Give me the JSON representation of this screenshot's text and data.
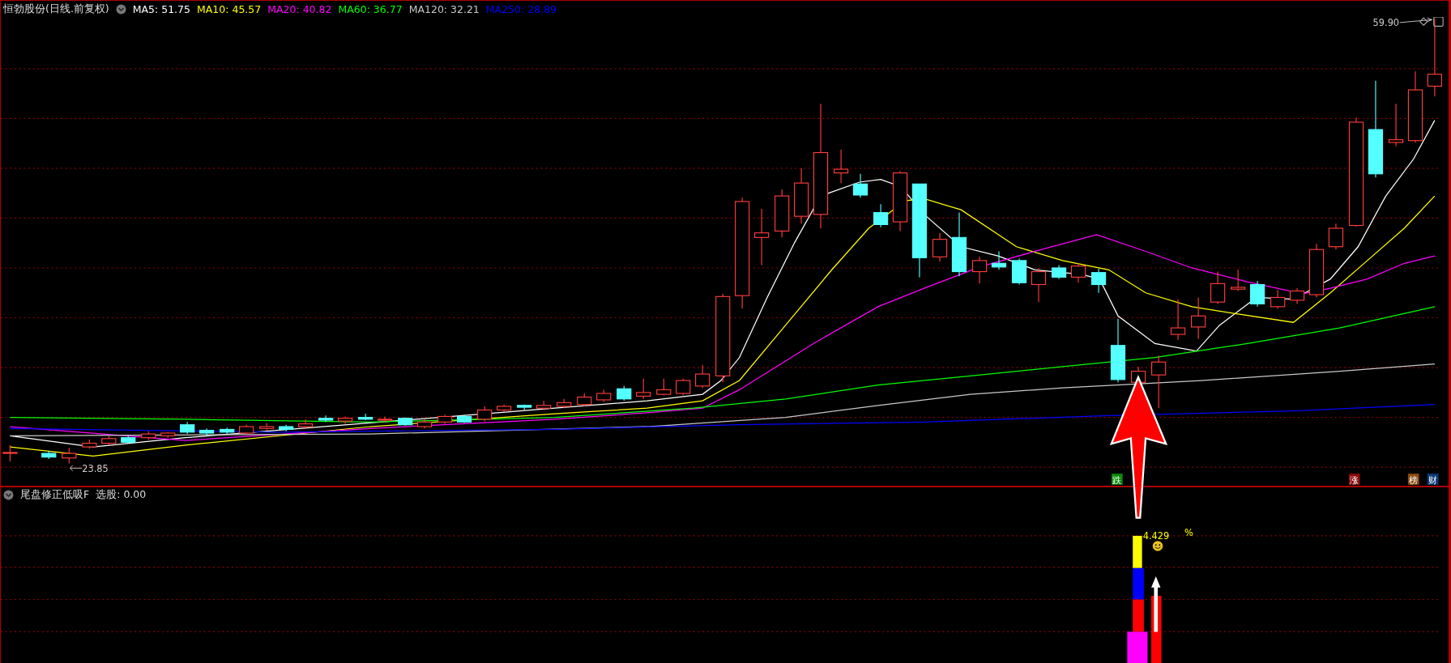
{
  "chart": {
    "title": "恒勃股份(日线.前复权)",
    "ma": [
      {
        "label": "MA5: 51.75",
        "color": "#ffffff"
      },
      {
        "label": "MA10: 45.57",
        "color": "#ffff00"
      },
      {
        "label": "MA20: 40.82",
        "color": "#ff00ff"
      },
      {
        "label": "MA60: 36.77",
        "color": "#00ff00"
      },
      {
        "label": "MA120: 32.21",
        "color": "#c8c8c8"
      },
      {
        "label": "MA250: 28.89",
        "color": "#0000ff"
      }
    ],
    "high_label": "59.90",
    "low_label": "23.85",
    "signals": [
      {
        "text": "跌",
        "color": "#0a8a0a"
      },
      {
        "text": "涨",
        "color": "#8c0a0a"
      },
      {
        "text": "榜",
        "color": "#8c4a10"
      },
      {
        "text": "财",
        "color": "#0e3c78"
      }
    ]
  },
  "indicator": {
    "name": "尾盘修正低吸F",
    "value": "选股: 0.00",
    "reading": "4.429",
    "unit": "%"
  }
}
